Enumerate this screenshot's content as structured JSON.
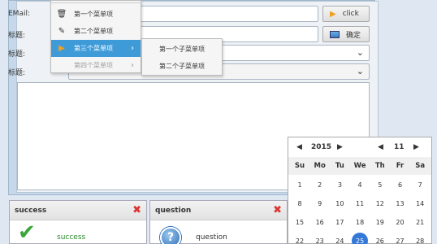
{
  "form": {
    "email_label": "EMail:",
    "title_label_1": "标题:",
    "title_label_2": "标题:",
    "title_label_3": "标题:",
    "click_button": "click",
    "confirm_button": "确定"
  },
  "menu": {
    "items": [
      {
        "label": "第一个菜单项",
        "icon": "trash-icon"
      },
      {
        "label": "第二个菜单项",
        "icon": "edit-icon"
      },
      {
        "label": "第三个菜单项",
        "icon": "play-icon"
      },
      {
        "label": "第四个菜单项",
        "icon": ""
      }
    ],
    "submenu": [
      "第一个子菜单项",
      "第二个子菜单项"
    ]
  },
  "cards": {
    "success": {
      "title": "success",
      "message": "success"
    },
    "question": {
      "title": "question",
      "message": "question"
    }
  },
  "calendar": {
    "year": "2015",
    "month": "11",
    "weekdays": [
      "Su",
      "Mo",
      "Tu",
      "We",
      "Th",
      "Fr",
      "Sa"
    ],
    "rows": [
      [
        "1",
        "2",
        "3",
        "4",
        "5",
        "6",
        "7"
      ],
      [
        "8",
        "9",
        "10",
        "11",
        "12",
        "13",
        "14"
      ],
      [
        "15",
        "16",
        "17",
        "18",
        "19",
        "20",
        "21"
      ],
      [
        "22",
        "23",
        "24",
        "25",
        "26",
        "27",
        "28"
      ]
    ],
    "selected": "25"
  },
  "colors": {
    "accent": "#3e9bd8",
    "selected_day": "#3478d8",
    "close": "#dd3333",
    "success_green": "#2a8a2a"
  }
}
